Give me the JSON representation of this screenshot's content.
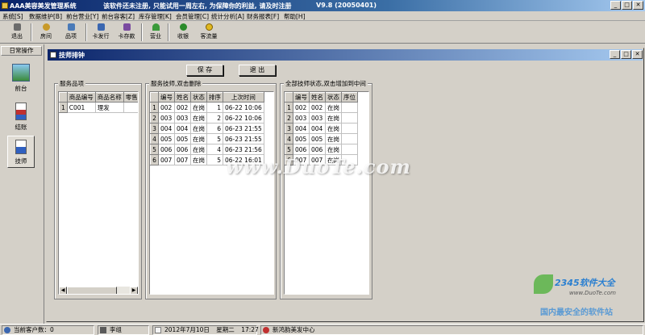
{
  "app": {
    "title": "AAA美容美发管理系统",
    "notice": "该软件还未注册, 只能试用一周左右, 为保障你的利益, 请及时注册",
    "version": "V9.8 (20050401)"
  },
  "menu": [
    "系统[S]",
    "数据维护[B]",
    "前台营业[Y]",
    "前台容客[Z]",
    "库存管理[K]",
    "会员管理[C]",
    "统计分析[A]",
    "财务报表[F]",
    "帮助[H]"
  ],
  "toolbar": [
    {
      "label": "退出",
      "icon": "exit-icon",
      "color": "#6b6b6b"
    },
    {
      "label": "房间",
      "icon": "room-icon",
      "color": "#c89a2a"
    },
    {
      "label": "品项",
      "icon": "item-icon",
      "color": "#4a7ab8"
    },
    {
      "label": "卡发行",
      "icon": "card-issue-icon",
      "color": "#3a66b0"
    },
    {
      "label": "卡存款",
      "icon": "card-deposit-icon",
      "color": "#7a4aa0"
    },
    {
      "label": "营业",
      "icon": "business-icon",
      "color": "#3a9a3a"
    },
    {
      "label": "收银",
      "icon": "cashier-icon",
      "color": "#2a8a2a"
    },
    {
      "label": "客流量",
      "icon": "traffic-icon",
      "color": "#e0b820"
    }
  ],
  "sidebar": {
    "header": "日常操作",
    "items": [
      {
        "label": "前台",
        "icon": "front-desk-icon"
      },
      {
        "label": "结账",
        "icon": "checkout-icon"
      },
      {
        "label": "技师",
        "icon": "technician-icon"
      }
    ]
  },
  "window": {
    "title": "技师排钟",
    "save_label": "保 存",
    "exit_label": "退 出"
  },
  "service_items": {
    "label": "服务品项",
    "columns": [
      "商品编号",
      "商品名称",
      "零售"
    ],
    "rows": [
      {
        "rh": "1",
        "code": "C001",
        "name": "理发",
        "price": ""
      }
    ]
  },
  "service_techs": {
    "label": "服务技师,双击删除",
    "columns": [
      "编号",
      "姓名",
      "状态",
      "排序",
      "上次时间"
    ],
    "rows": [
      {
        "rh": "1",
        "id": "002",
        "name": "002",
        "status": "在岗",
        "order": "1",
        "time": "06-22 10:06"
      },
      {
        "rh": "2",
        "id": "003",
        "name": "003",
        "status": "在岗",
        "order": "2",
        "time": "06-22 10:06"
      },
      {
        "rh": "3",
        "id": "004",
        "name": "004",
        "status": "在岗",
        "order": "6",
        "time": "06-23 21:55"
      },
      {
        "rh": "4",
        "id": "005",
        "name": "005",
        "status": "在岗",
        "order": "5",
        "time": "06-23 21:55"
      },
      {
        "rh": "5",
        "id": "006",
        "name": "006",
        "status": "在岗",
        "order": "4",
        "time": "06-23 21:56"
      },
      {
        "rh": "6",
        "id": "007",
        "name": "007",
        "status": "在岗",
        "order": "5",
        "time": "06-22 16:01"
      }
    ]
  },
  "all_techs": {
    "label": "全部技师状态,双击增加到中间",
    "columns": [
      "编号",
      "姓名",
      "状态",
      "序位"
    ],
    "rows": [
      {
        "rh": "1",
        "id": "002",
        "name": "002",
        "status": "在岗",
        "pos": ""
      },
      {
        "rh": "2",
        "id": "003",
        "name": "003",
        "status": "在岗",
        "pos": ""
      },
      {
        "rh": "3",
        "id": "004",
        "name": "004",
        "status": "在岗",
        "pos": ""
      },
      {
        "rh": "4",
        "id": "005",
        "name": "005",
        "status": "在岗",
        "pos": ""
      },
      {
        "rh": "5",
        "id": "006",
        "name": "006",
        "status": "在岗",
        "pos": ""
      },
      {
        "rh": "6",
        "id": "007",
        "name": "007",
        "status": "在岗",
        "pos": ""
      }
    ]
  },
  "watermark": {
    "site": "www.DuoTe.com",
    "brand": "2345软件大全",
    "url": "www.DuoTe.com",
    "slogan": "国内最安全的软件站"
  },
  "statusbar": {
    "customers": "当前客户数：0",
    "user": "李组",
    "date": "2012年7月10日",
    "weekday": "星期二",
    "time": "17:27",
    "shop": "新鸿韵美发中心"
  }
}
